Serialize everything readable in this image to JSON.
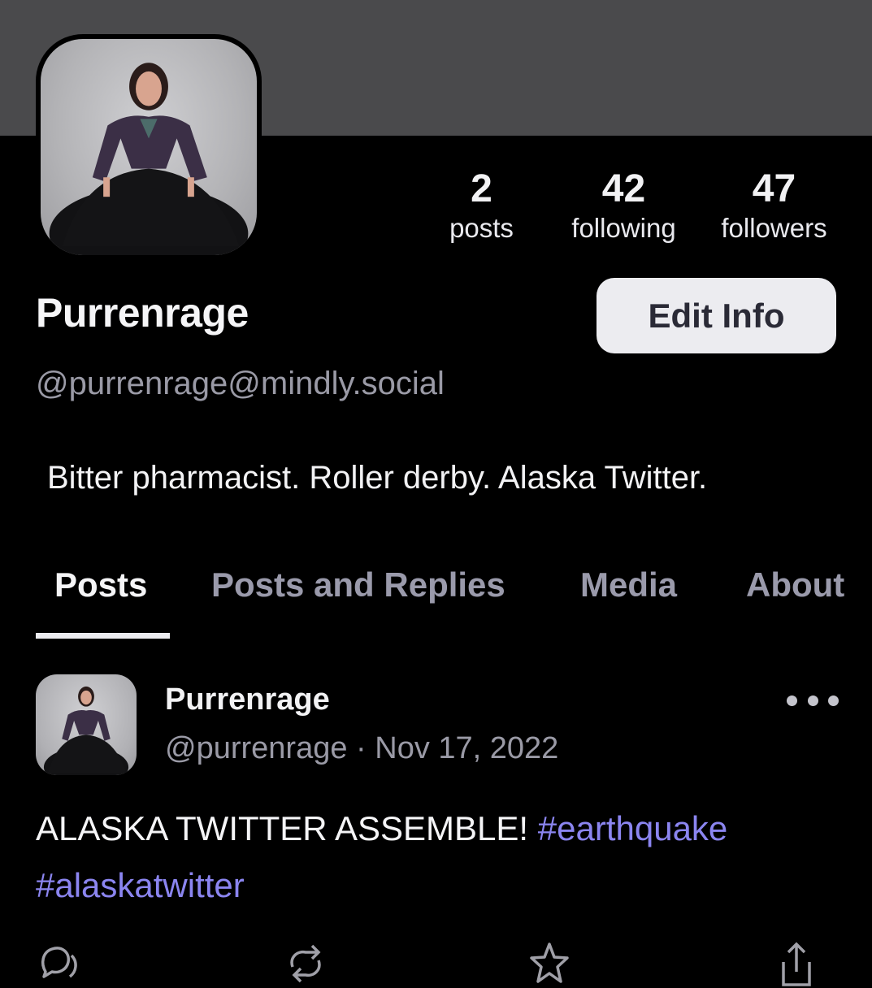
{
  "profile": {
    "display_name": "Purrenrage",
    "handle": "@purrenrage@mindly.social",
    "bio": "Bitter pharmacist. Roller derby. Alaska Twitter.",
    "avatar_icon": "profile-photo",
    "banner_color": "#4a4a4c"
  },
  "stats": [
    {
      "value": "2",
      "label": "posts"
    },
    {
      "value": "42",
      "label": "following"
    },
    {
      "value": "47",
      "label": "followers"
    }
  ],
  "edit_button": {
    "label": "Edit Info"
  },
  "tabs": [
    {
      "label": "Posts",
      "active": true
    },
    {
      "label": "Posts and Replies",
      "active": false
    },
    {
      "label": "Media",
      "active": false
    },
    {
      "label": "About",
      "active": false
    }
  ],
  "post": {
    "author_name": "Purrenrage",
    "author_handle": "@purrenrage",
    "separator": "·",
    "date": "Nov 17, 2022",
    "text": "ALASKA TWITTER ASSEMBLE!",
    "hashtags": [
      "#earthquake",
      "#alaskatwitter"
    ],
    "more_icon": "ellipsis-icon",
    "actions": [
      {
        "icon": "reply-icon"
      },
      {
        "icon": "boost-icon"
      },
      {
        "icon": "favorite-star-icon"
      },
      {
        "icon": "share-icon"
      }
    ]
  },
  "colors": {
    "background": "#000000",
    "accent_hashtag": "#8b85f0",
    "secondary_text": "#9a9aa6",
    "button_bg": "#ececf0"
  }
}
